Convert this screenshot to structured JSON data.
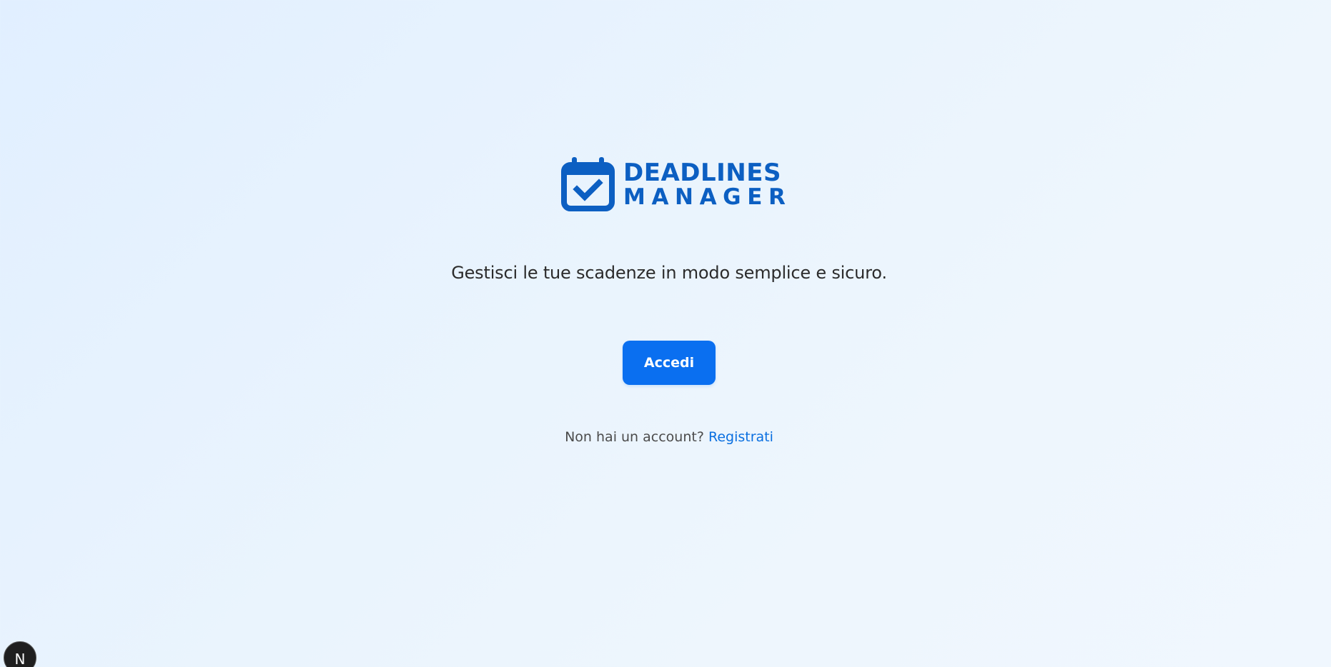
{
  "logo": {
    "line1": "DEADLINES",
    "line2": "MANAGER",
    "icon": "calendar-check-icon",
    "color": "#0c5fc2"
  },
  "tagline": "Gestisci le tue scadenze in modo semplice e sicuro.",
  "login_button": {
    "label": "Accedi",
    "color": "#0a6ff0"
  },
  "signup": {
    "prompt": "Non hai un account?",
    "link_label": "Registrati",
    "link_color": "#0a6fe0"
  },
  "dev_badge": {
    "label": "N",
    "icon": "nextjs-icon"
  }
}
